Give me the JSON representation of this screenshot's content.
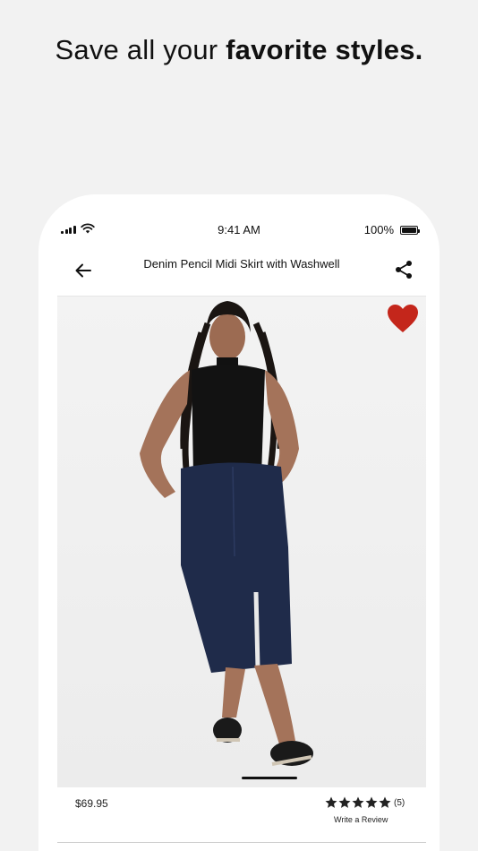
{
  "headline": {
    "regular": "Save all your ",
    "bold": "favorite styles."
  },
  "status_bar": {
    "time": "9:41 AM",
    "battery": "100%"
  },
  "nav": {
    "title": "Denim Pencil Midi Skirt with Washwell"
  },
  "product": {
    "price": "$69.95",
    "rating": 5,
    "review_count": "(5)",
    "write_review": "Write a Review",
    "favorited": true
  },
  "colors": {
    "favorite_heart": "#c4261b",
    "background": "#f2f2f2"
  },
  "icons": [
    "cellular-signal-icon",
    "wifi-icon",
    "battery-icon",
    "back-arrow-icon",
    "share-icon",
    "heart-icon",
    "star-icon"
  ]
}
